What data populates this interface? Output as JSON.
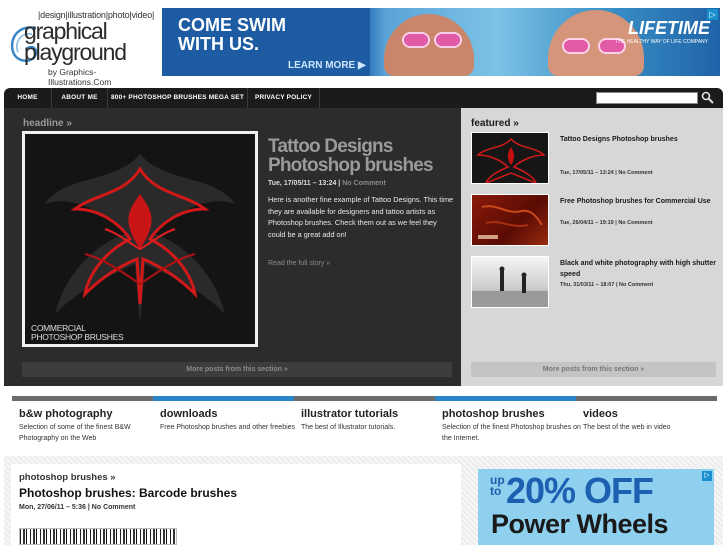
{
  "logo": {
    "tagline": "|design|illustration|photo|video|",
    "line1": "graphical",
    "line2": "playground",
    "byline": "by Graphics-Illustrations.Com"
  },
  "banner": {
    "headline1": "COME SWIM",
    "headline2": "WITH US.",
    "cta": "LEARN MORE ▶",
    "brand": "LIFETIME",
    "brand_sub": "THE HEALTHY WAY OF LIFE COMPANY",
    "ad_tag": "▷"
  },
  "nav": {
    "items": [
      {
        "label": "HOME"
      },
      {
        "label": "ABOUT ME"
      },
      {
        "label": "800+ PHOTOSHOP BRUSHES MEGA SET"
      },
      {
        "label": "PRIVACY POLICY"
      }
    ],
    "search_value": ""
  },
  "headline": {
    "section_label": "headline »",
    "title": "Tattoo Designs Photoshop brushes",
    "date": "Tue, 17/05/11 – 13:24 |",
    "comments": "No Comment",
    "body": "Here is another fine example of Tattoo Designs. This time they are available for designers and tattoo artists as Photoshop brushes. Check them out as we feel they could be a great add on!",
    "read_more": "Read the full story »",
    "image_caption_1": "COMMERCIAL",
    "image_caption_2": "PHOTOSHOP BRUSHES",
    "more_posts": "More posts from this section »"
  },
  "featured": {
    "section_label": "featured »",
    "items": [
      {
        "title": "Tattoo Designs Photoshop brushes",
        "date": "Tue, 17/05/11 – 13:24 |",
        "comments": "No Comment"
      },
      {
        "title": "Free Photoshop brushes for Commercial Use",
        "date": "Tue, 26/04/11 – 19:19 |",
        "comments": "No Comment"
      },
      {
        "title": "Black and white photography with high shutter speed",
        "date": "Thu, 31/03/11 – 18:07 |",
        "comments": "No Comment"
      }
    ],
    "more_posts": "More posts from this section »"
  },
  "categories": [
    {
      "title": "b&w photography",
      "desc": "Selection of some of the finest B&W Photography on the Web",
      "color": "#6b6b6b"
    },
    {
      "title": "downloads",
      "desc": "Free Photoshop brushes and other freebies",
      "color": "#2a86c8"
    },
    {
      "title": "illustrator tutorials",
      "desc": "The best of Illustrator tutorials.",
      "color": "#6b6b6b"
    },
    {
      "title": "photoshop brushes",
      "desc": "Selection of the finest Photoshop brushes on the Internet.",
      "color": "#2a86c8"
    },
    {
      "title": "videos",
      "desc": "The best of the web in video",
      "color": "#6b6b6b"
    }
  ],
  "latest": {
    "section_label": "photoshop brushes »",
    "title": "Photoshop brushes: Barcode brushes",
    "date": "Mon, 27/06/11 – 5:36 |",
    "comments": "No Comment"
  },
  "ad2": {
    "upto_1": "up",
    "upto_2": "to",
    "offer": "20% OFF",
    "product": "Power Wheels",
    "ad_tag": "▷"
  }
}
